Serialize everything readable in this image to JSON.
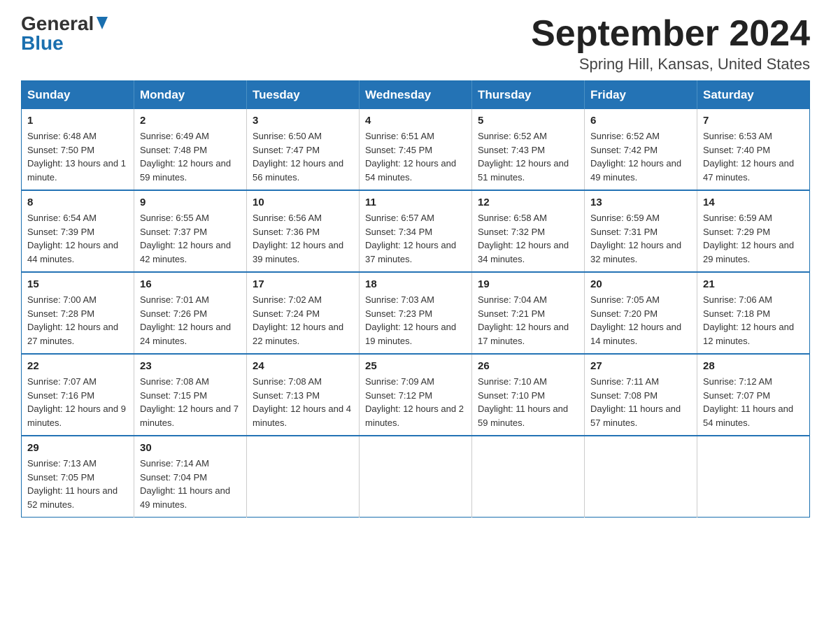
{
  "logo": {
    "general": "General",
    "blue": "Blue"
  },
  "title": {
    "month_year": "September 2024",
    "location": "Spring Hill, Kansas, United States"
  },
  "weekdays": [
    "Sunday",
    "Monday",
    "Tuesday",
    "Wednesday",
    "Thursday",
    "Friday",
    "Saturday"
  ],
  "weeks": [
    [
      {
        "day": "1",
        "sunrise": "Sunrise: 6:48 AM",
        "sunset": "Sunset: 7:50 PM",
        "daylight": "Daylight: 13 hours and 1 minute."
      },
      {
        "day": "2",
        "sunrise": "Sunrise: 6:49 AM",
        "sunset": "Sunset: 7:48 PM",
        "daylight": "Daylight: 12 hours and 59 minutes."
      },
      {
        "day": "3",
        "sunrise": "Sunrise: 6:50 AM",
        "sunset": "Sunset: 7:47 PM",
        "daylight": "Daylight: 12 hours and 56 minutes."
      },
      {
        "day": "4",
        "sunrise": "Sunrise: 6:51 AM",
        "sunset": "Sunset: 7:45 PM",
        "daylight": "Daylight: 12 hours and 54 minutes."
      },
      {
        "day": "5",
        "sunrise": "Sunrise: 6:52 AM",
        "sunset": "Sunset: 7:43 PM",
        "daylight": "Daylight: 12 hours and 51 minutes."
      },
      {
        "day": "6",
        "sunrise": "Sunrise: 6:52 AM",
        "sunset": "Sunset: 7:42 PM",
        "daylight": "Daylight: 12 hours and 49 minutes."
      },
      {
        "day": "7",
        "sunrise": "Sunrise: 6:53 AM",
        "sunset": "Sunset: 7:40 PM",
        "daylight": "Daylight: 12 hours and 47 minutes."
      }
    ],
    [
      {
        "day": "8",
        "sunrise": "Sunrise: 6:54 AM",
        "sunset": "Sunset: 7:39 PM",
        "daylight": "Daylight: 12 hours and 44 minutes."
      },
      {
        "day": "9",
        "sunrise": "Sunrise: 6:55 AM",
        "sunset": "Sunset: 7:37 PM",
        "daylight": "Daylight: 12 hours and 42 minutes."
      },
      {
        "day": "10",
        "sunrise": "Sunrise: 6:56 AM",
        "sunset": "Sunset: 7:36 PM",
        "daylight": "Daylight: 12 hours and 39 minutes."
      },
      {
        "day": "11",
        "sunrise": "Sunrise: 6:57 AM",
        "sunset": "Sunset: 7:34 PM",
        "daylight": "Daylight: 12 hours and 37 minutes."
      },
      {
        "day": "12",
        "sunrise": "Sunrise: 6:58 AM",
        "sunset": "Sunset: 7:32 PM",
        "daylight": "Daylight: 12 hours and 34 minutes."
      },
      {
        "day": "13",
        "sunrise": "Sunrise: 6:59 AM",
        "sunset": "Sunset: 7:31 PM",
        "daylight": "Daylight: 12 hours and 32 minutes."
      },
      {
        "day": "14",
        "sunrise": "Sunrise: 6:59 AM",
        "sunset": "Sunset: 7:29 PM",
        "daylight": "Daylight: 12 hours and 29 minutes."
      }
    ],
    [
      {
        "day": "15",
        "sunrise": "Sunrise: 7:00 AM",
        "sunset": "Sunset: 7:28 PM",
        "daylight": "Daylight: 12 hours and 27 minutes."
      },
      {
        "day": "16",
        "sunrise": "Sunrise: 7:01 AM",
        "sunset": "Sunset: 7:26 PM",
        "daylight": "Daylight: 12 hours and 24 minutes."
      },
      {
        "day": "17",
        "sunrise": "Sunrise: 7:02 AM",
        "sunset": "Sunset: 7:24 PM",
        "daylight": "Daylight: 12 hours and 22 minutes."
      },
      {
        "day": "18",
        "sunrise": "Sunrise: 7:03 AM",
        "sunset": "Sunset: 7:23 PM",
        "daylight": "Daylight: 12 hours and 19 minutes."
      },
      {
        "day": "19",
        "sunrise": "Sunrise: 7:04 AM",
        "sunset": "Sunset: 7:21 PM",
        "daylight": "Daylight: 12 hours and 17 minutes."
      },
      {
        "day": "20",
        "sunrise": "Sunrise: 7:05 AM",
        "sunset": "Sunset: 7:20 PM",
        "daylight": "Daylight: 12 hours and 14 minutes."
      },
      {
        "day": "21",
        "sunrise": "Sunrise: 7:06 AM",
        "sunset": "Sunset: 7:18 PM",
        "daylight": "Daylight: 12 hours and 12 minutes."
      }
    ],
    [
      {
        "day": "22",
        "sunrise": "Sunrise: 7:07 AM",
        "sunset": "Sunset: 7:16 PM",
        "daylight": "Daylight: 12 hours and 9 minutes."
      },
      {
        "day": "23",
        "sunrise": "Sunrise: 7:08 AM",
        "sunset": "Sunset: 7:15 PM",
        "daylight": "Daylight: 12 hours and 7 minutes."
      },
      {
        "day": "24",
        "sunrise": "Sunrise: 7:08 AM",
        "sunset": "Sunset: 7:13 PM",
        "daylight": "Daylight: 12 hours and 4 minutes."
      },
      {
        "day": "25",
        "sunrise": "Sunrise: 7:09 AM",
        "sunset": "Sunset: 7:12 PM",
        "daylight": "Daylight: 12 hours and 2 minutes."
      },
      {
        "day": "26",
        "sunrise": "Sunrise: 7:10 AM",
        "sunset": "Sunset: 7:10 PM",
        "daylight": "Daylight: 11 hours and 59 minutes."
      },
      {
        "day": "27",
        "sunrise": "Sunrise: 7:11 AM",
        "sunset": "Sunset: 7:08 PM",
        "daylight": "Daylight: 11 hours and 57 minutes."
      },
      {
        "day": "28",
        "sunrise": "Sunrise: 7:12 AM",
        "sunset": "Sunset: 7:07 PM",
        "daylight": "Daylight: 11 hours and 54 minutes."
      }
    ],
    [
      {
        "day": "29",
        "sunrise": "Sunrise: 7:13 AM",
        "sunset": "Sunset: 7:05 PM",
        "daylight": "Daylight: 11 hours and 52 minutes."
      },
      {
        "day": "30",
        "sunrise": "Sunrise: 7:14 AM",
        "sunset": "Sunset: 7:04 PM",
        "daylight": "Daylight: 11 hours and 49 minutes."
      },
      null,
      null,
      null,
      null,
      null
    ]
  ]
}
